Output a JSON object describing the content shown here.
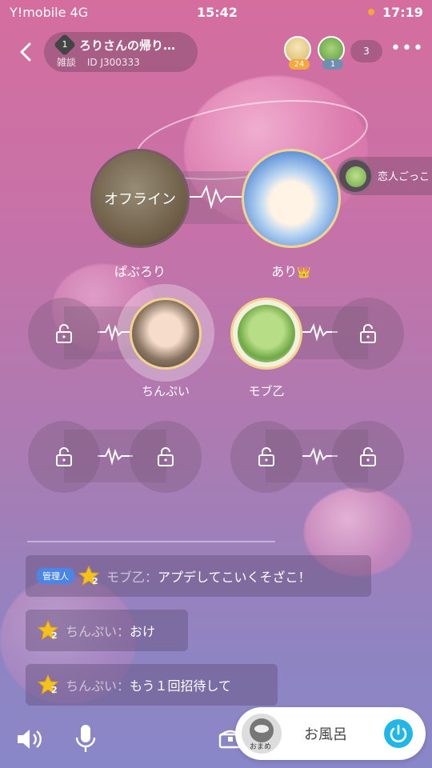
{
  "status_bar": {
    "carrier": "Y!mobile  4G",
    "time": "15:42",
    "battery": "17:19"
  },
  "room": {
    "level": "1",
    "title": "ろりさんの帰り…",
    "category": "雑談",
    "id_label": "ID J300333"
  },
  "top_viewers": [
    {
      "badge": "24",
      "badge_color": "#f4a93a"
    },
    {
      "badge": "1",
      "badge_color": "#6e8fb0"
    }
  ],
  "viewer_count": "3",
  "side_tag": {
    "label": "恋人ごっこ"
  },
  "seats": [
    {
      "name": "ぱぶろり",
      "status": "オフライン"
    },
    {
      "name": "あり",
      "crown": "👑"
    },
    {
      "name": "ちんぷい"
    },
    {
      "name": "モブ乙"
    }
  ],
  "messages": [
    {
      "admin_badge": "管理人",
      "star_level": "2",
      "name": "モブ乙：",
      "text": "アプデしてこいくそざこ！"
    },
    {
      "star_level": "2",
      "name": "ちんぷい：",
      "text": "おけ"
    },
    {
      "star_level": "2",
      "name": "ちんぷい：",
      "text": "もう１回招待して"
    }
  ],
  "now_playing": {
    "title": "お風呂",
    "thumb_text": "おまめ"
  },
  "colors": {
    "accent": "#1fb6e8",
    "admin": "#4a86e8",
    "star": "#f4c21f"
  }
}
